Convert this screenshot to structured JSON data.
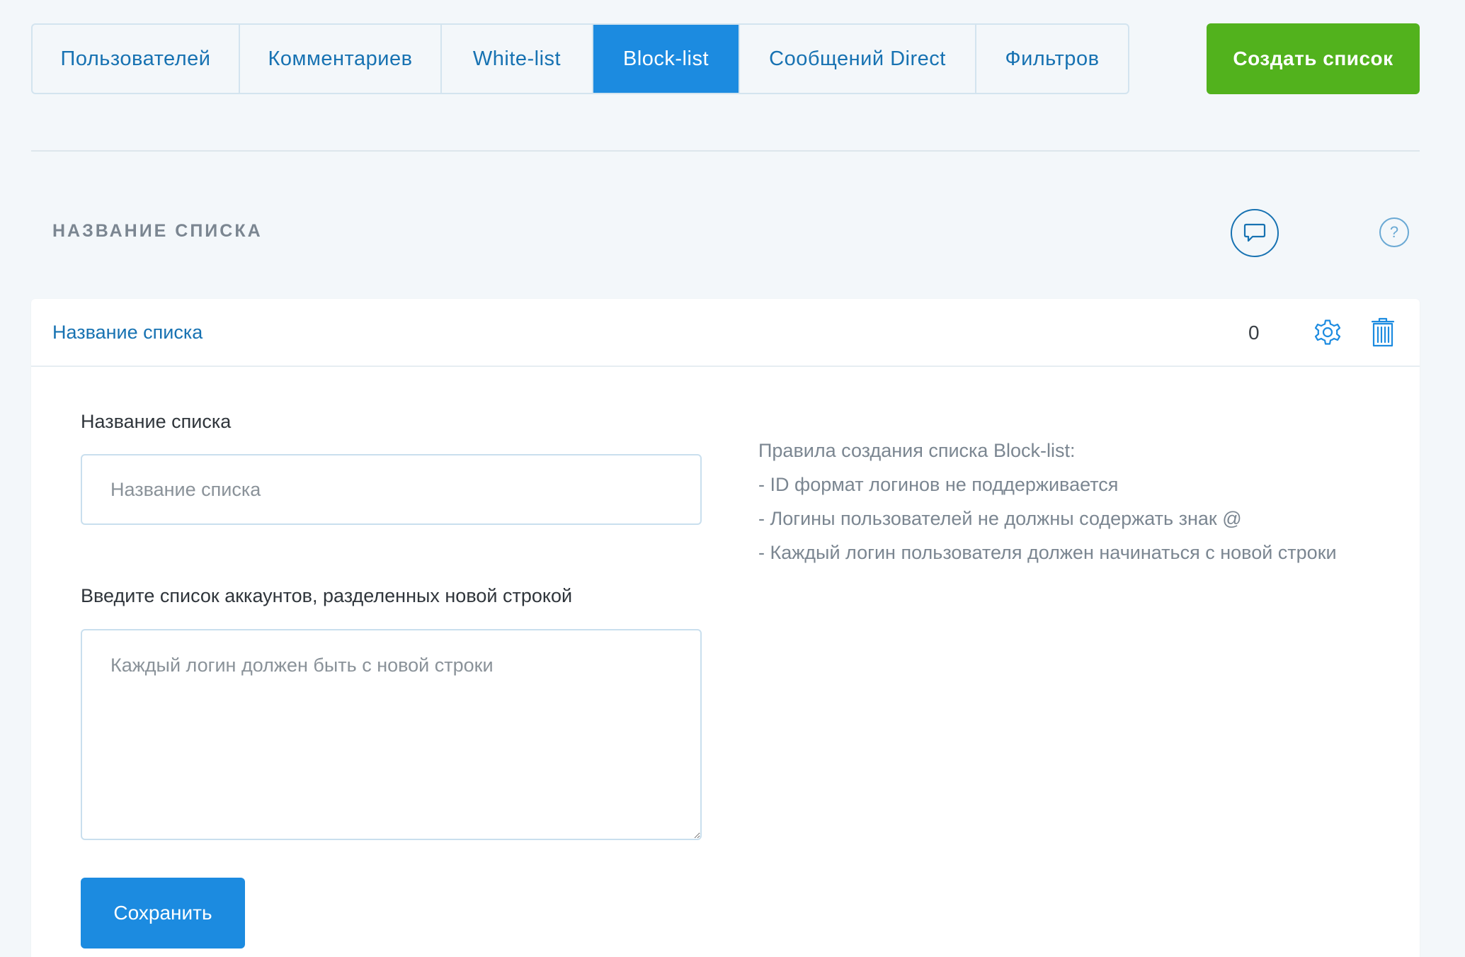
{
  "tabs": [
    {
      "label": "Пользователей"
    },
    {
      "label": "Комментариев"
    },
    {
      "label": "White-list"
    },
    {
      "label": "Block-list",
      "active": true
    },
    {
      "label": "Сообщений Direct"
    },
    {
      "label": "Фильтров"
    }
  ],
  "create_button": "Создать список",
  "section_title": "НАЗВАНИЕ СПИСКА",
  "icons": {
    "chat": "chat-bubble-icon",
    "help": "?"
  },
  "list": {
    "name": "Название списка",
    "count": "0"
  },
  "form": {
    "name_label": "Название списка",
    "name_placeholder": "Название списка",
    "accounts_label": "Введите список аккаунтов, разделенных новой строкой",
    "accounts_placeholder": "Каждый логин должен быть с новой строки",
    "save_label": "Сохранить"
  },
  "rules": {
    "title": "Правила создания списка Block-list:",
    "items": [
      "- ID формат логинов не поддерживается",
      "- Логины пользователей не должны содержать знак @",
      "- Каждый логин пользователя должен начинаться с новой строки"
    ]
  },
  "colors": {
    "accent": "#1c8be0",
    "link": "#1772b2",
    "create": "#52b21d",
    "background": "#f3f7fa"
  }
}
